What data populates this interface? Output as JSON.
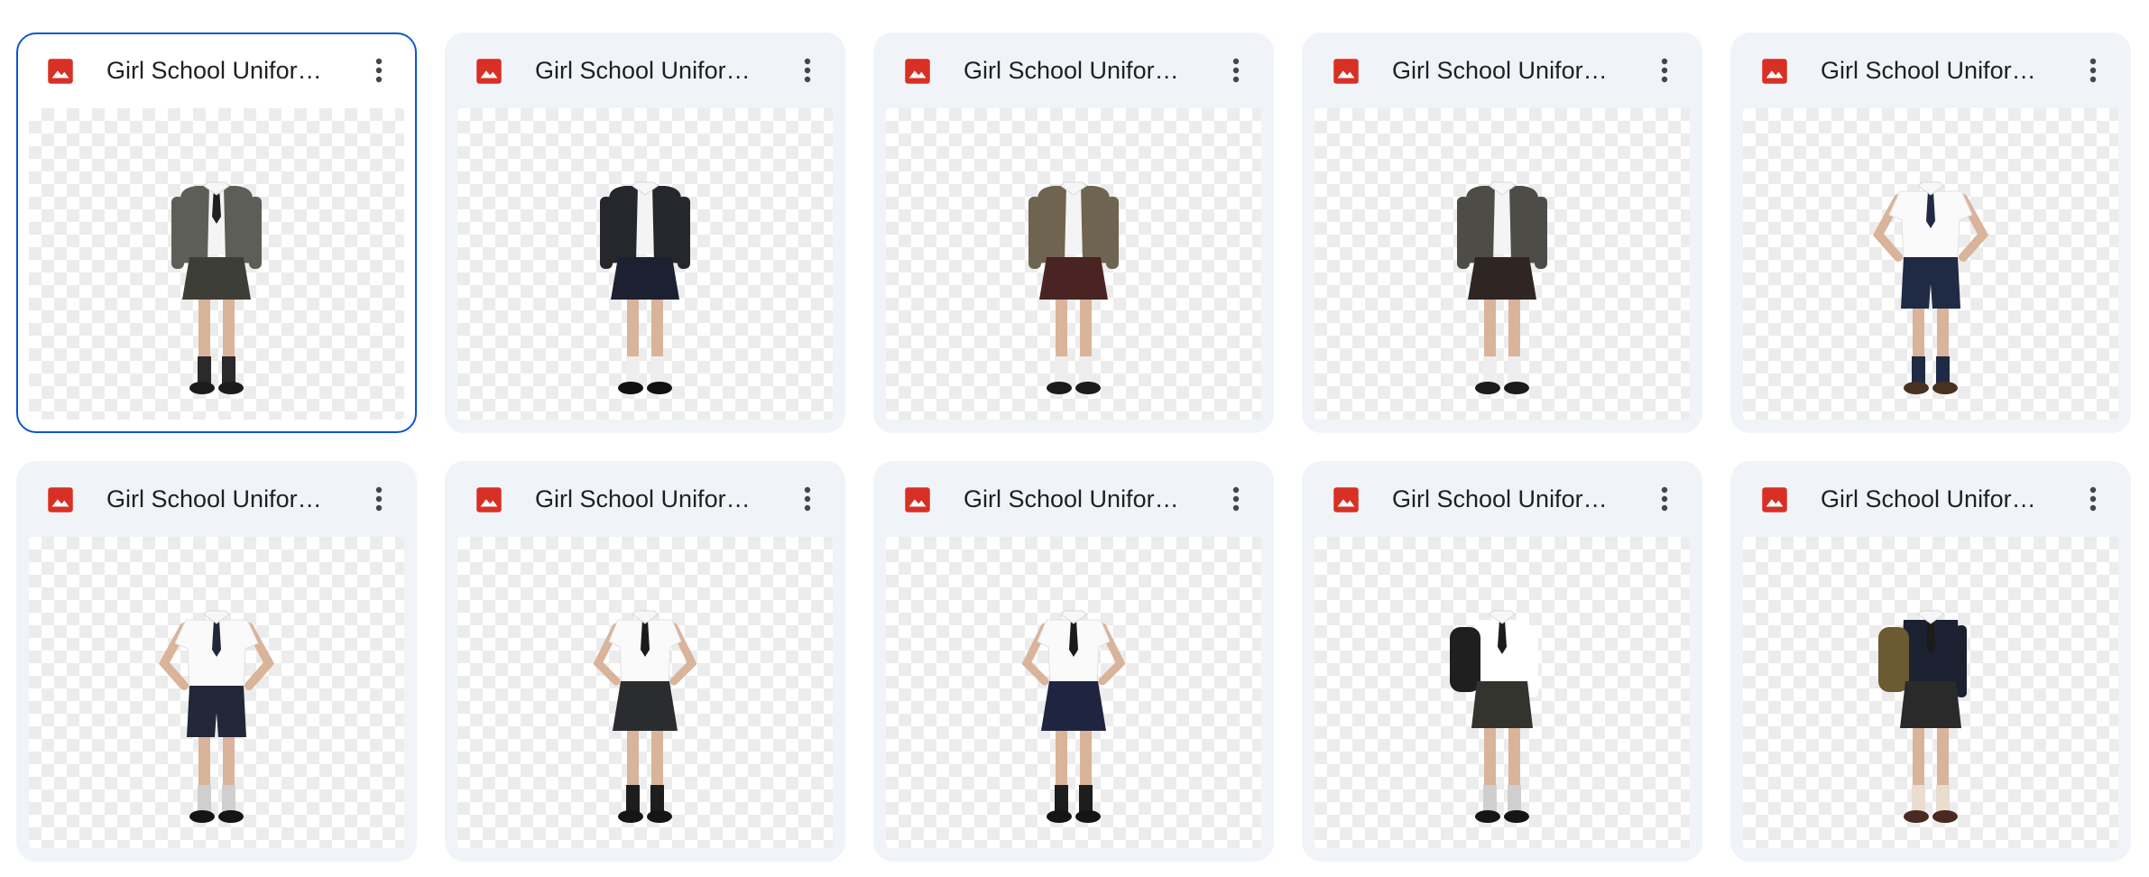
{
  "files": [
    {
      "title": "Girl School Uniform ...",
      "selected": true,
      "jacket": "#5e5e58",
      "bottom": "#3d3f36",
      "style": "blazer-skirt",
      "tie": true,
      "shoes": "#1b1b1b",
      "socks": "#2a2a2a"
    },
    {
      "title": "Girl School Uniform ...",
      "selected": false,
      "jacket": "#26272d",
      "bottom": "#1d2030",
      "style": "blazer-skirt",
      "tie": false,
      "shoes": "#111111",
      "socks": "#eeeeee"
    },
    {
      "title": "Girl School Uniform ...",
      "selected": false,
      "jacket": "#6f6450",
      "bottom": "#4a2323",
      "style": "blazer-skirt",
      "tie": false,
      "shoes": "#1b1b1b",
      "socks": "#eeeeee"
    },
    {
      "title": "Girl School Uniform ...",
      "selected": false,
      "jacket": "#4e4c47",
      "bottom": "#2f2624",
      "style": "blazer-skirt",
      "tie": false,
      "shoes": "#1b1b1b",
      "socks": "#eeeeee"
    },
    {
      "title": "Girl School Uniform ...",
      "selected": false,
      "jacket": "#ffffff",
      "bottom": "#1f2a45",
      "style": "shirt-shorts",
      "tie": true,
      "shoes": "#4a3020",
      "socks": "#1f2a45"
    },
    {
      "title": "Girl School Uniform ...",
      "selected": false,
      "jacket": "#ffffff",
      "bottom": "#22273a",
      "style": "shirt-shorts",
      "tie": true,
      "shoes": "#151515",
      "socks": "#cfcfcf"
    },
    {
      "title": "Girl School Uniform ...",
      "selected": false,
      "jacket": "#ffffff",
      "bottom": "#2a2c30",
      "style": "shirt-skirt",
      "tie": true,
      "shoes": "#151515",
      "socks": "#1d1d1d"
    },
    {
      "title": "Girl School Uniform ...",
      "selected": false,
      "jacket": "#ffffff",
      "bottom": "#1f2440",
      "style": "shirt-skirt",
      "tie": true,
      "shoes": "#151515",
      "socks": "#1d1d1d"
    },
    {
      "title": "Girl School Uniform ...",
      "selected": false,
      "jacket": "#ffffff",
      "bottom": "#34342f",
      "style": "backpack-black",
      "tie": true,
      "shoes": "#151515",
      "socks": "#cfcfcf"
    },
    {
      "title": "Girl School Uniform ...",
      "selected": false,
      "jacket": "#1b2130",
      "bottom": "#2a2a2a",
      "style": "backpack-olive",
      "tie": true,
      "shoes": "#4a2a20",
      "socks": "#e9ddd0"
    }
  ],
  "icons": {
    "file_type": "image-file-icon",
    "more": "more-vert-icon"
  },
  "colors": {
    "accent": "#0b57d0",
    "image_icon": "#d93025",
    "card_bg": "#f0f4f9"
  }
}
